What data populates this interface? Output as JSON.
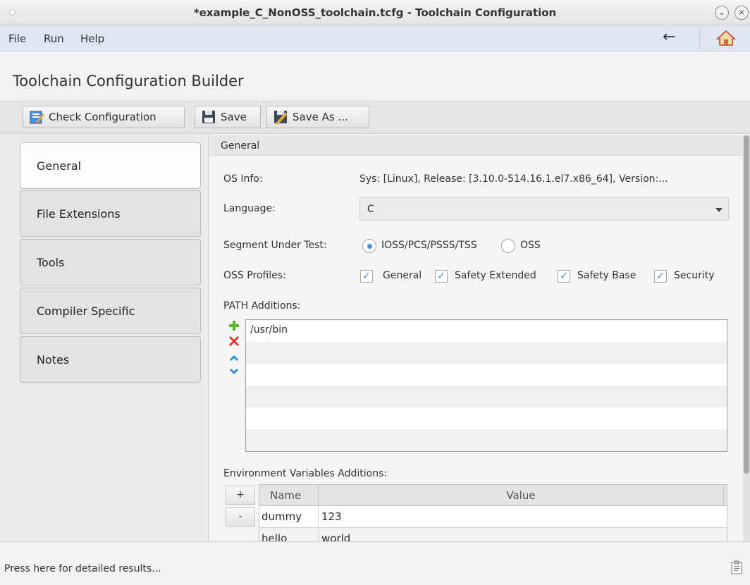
{
  "window": {
    "title": "*example_C_NonOSS_toolchain.tcfg - Toolchain Configuration",
    "minimize_glyph": "⌄",
    "close_glyph": "×"
  },
  "menubar": {
    "items": [
      "File",
      "Run",
      "Help"
    ],
    "back_icon": "arrow-left-icon",
    "back_glyph": "←",
    "home_icon": "home-icon"
  },
  "heading": {
    "title": "Toolchain Configuration Builder"
  },
  "toolbar": {
    "check_label": "Check Configuration",
    "save_label": "Save",
    "save_as_label": "Save As ..."
  },
  "sidetabs": {
    "items": [
      {
        "label": "General",
        "active": true
      },
      {
        "label": "File Extensions",
        "active": false
      },
      {
        "label": "Tools",
        "active": false
      },
      {
        "label": "Compiler Specific",
        "active": false
      },
      {
        "label": "Notes",
        "active": false
      }
    ]
  },
  "general": {
    "section_title": "General",
    "os_info_label": "OS Info:",
    "os_info_value": "Sys: [Linux], Release: [3.10.0-514.16.1.el7.x86_64], Version:...",
    "language_label": "Language:",
    "language_value": "C",
    "segment_label": "Segment Under Test:",
    "segment_options": [
      {
        "label": "IOSS/PCS/PSSS/TSS",
        "selected": true
      },
      {
        "label": "OSS",
        "selected": false
      }
    ],
    "profiles_label": "OSS Profiles:",
    "profiles": [
      {
        "label": "General",
        "checked": true,
        "check_glyph": "✓"
      },
      {
        "label": "Safety Extended",
        "checked": true,
        "check_glyph": "✓"
      },
      {
        "label": "Safety Base",
        "checked": true,
        "check_glyph": "✓"
      },
      {
        "label": "Security",
        "checked": true,
        "check_glyph": "✓"
      }
    ],
    "path_label": "PATH Additions:",
    "path_items": [
      "/usr/bin"
    ],
    "env_label": "Environment Variables Additions:",
    "env_add_label": "+",
    "env_remove_label": "-",
    "env_columns": [
      "Name",
      "Value"
    ],
    "env_rows": [
      {
        "name": "dummy",
        "value": "123"
      },
      {
        "name": "hello",
        "value": "world"
      }
    ]
  },
  "status": {
    "text": "Press here for detailed results..."
  },
  "colors": {
    "accent": "#4a90d9",
    "menubar": "#dde6f1",
    "add": "#5cb82e",
    "remove": "#e0331e",
    "arrow": "#2f8bd8"
  }
}
